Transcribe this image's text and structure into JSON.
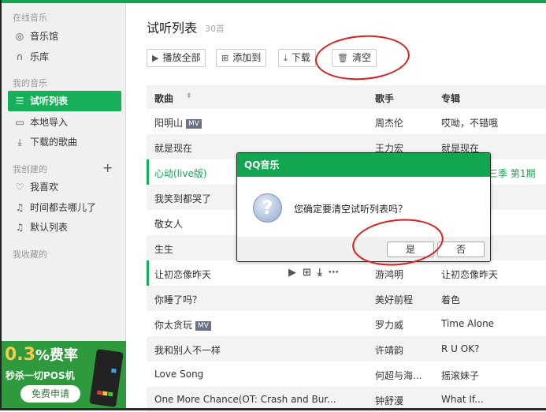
{
  "sidebar": {
    "sections": [
      "在线音乐",
      "我的音乐",
      "我创建的",
      "我收藏的"
    ],
    "online": [
      {
        "icon": "music-hall-icon",
        "label": "音乐馆"
      },
      {
        "icon": "headphones-icon",
        "label": "乐库"
      }
    ],
    "mine": [
      {
        "icon": "list-icon",
        "label": "试听列表",
        "active": true
      },
      {
        "icon": "monitor-icon",
        "label": "本地导入"
      },
      {
        "icon": "download-icon",
        "label": "下载的歌曲"
      }
    ],
    "created": [
      {
        "icon": "heart-icon",
        "label": "我喜欢"
      },
      {
        "icon": "music-note-icon",
        "label": "时间都去哪儿了"
      },
      {
        "icon": "music-note-icon",
        "label": "默认列表"
      }
    ],
    "ad": {
      "rate": "0.3",
      "pct": "%费率",
      "line2": "秒杀一切POS机",
      "cta": "免费申请"
    }
  },
  "main": {
    "title": "试听列表",
    "count": "30首",
    "toolbar": {
      "play_all": "播放全部",
      "add_to": "添加到",
      "download": "下载",
      "clear": "清空"
    },
    "columns": [
      "歌曲",
      "歌手",
      "专辑"
    ],
    "rows": [
      {
        "song": "阳明山",
        "mv": "MV",
        "singer": "周杰伦",
        "album": "哎呦，不错哦"
      },
      {
        "song": "就是现在",
        "singer": "王力宏",
        "album": "就是现在"
      },
      {
        "song": "心动(live版)",
        "singer": "",
        "album": "三季 第1期",
        "playing": true
      },
      {
        "song": "我笑到都哭了",
        "singer": "",
        "album": ""
      },
      {
        "song": "敬女人",
        "singer": "",
        "album": ""
      },
      {
        "song": "生生",
        "singer": "",
        "album": ""
      },
      {
        "song": "让初恋像昨天",
        "singer": "游鸿明",
        "album": "让初恋像昨天",
        "hover": true
      },
      {
        "song": "你睡了吗？",
        "singer": "美好前程",
        "album": "着色"
      },
      {
        "song": "你太贪玩",
        "mv": "MV",
        "singer": "罗力威",
        "album": "Time Alone"
      },
      {
        "song": "我和别人不一样",
        "singer": "许靖韵",
        "album": "R U OK?"
      },
      {
        "song": "Love Song",
        "singer": "何超与海...",
        "album": "摇滚妹子"
      },
      {
        "song": "One More Chance(OT: Crash and Bur...",
        "singer": "钟舒漫",
        "album": "What If..."
      }
    ]
  },
  "dialog": {
    "title": "QQ音乐",
    "message": "您确定要清空试听列表吗？",
    "yes": "是",
    "no": "否"
  },
  "colors": {
    "accent": "#12a650",
    "annotation": "#d81e1e"
  }
}
